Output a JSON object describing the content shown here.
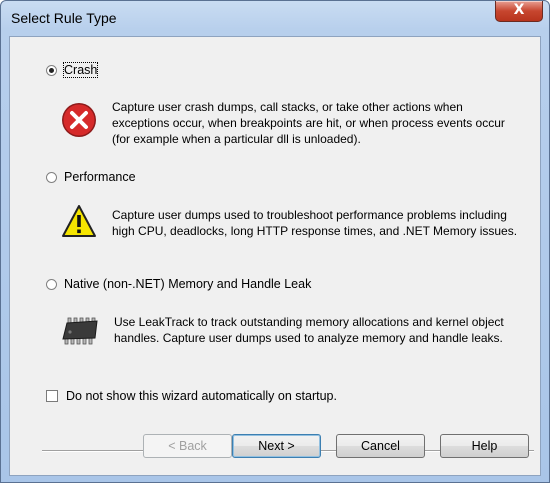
{
  "window": {
    "title": "Select Rule Type",
    "close_glyph": "X"
  },
  "options": [
    {
      "label": "Crash",
      "selected": true,
      "icon": "error-icon",
      "description": "Capture user crash dumps, call stacks, or take other actions when exceptions occur, when breakpoints are hit, or when process events occur (for example when a particular dll is unloaded)."
    },
    {
      "label": "Performance",
      "selected": false,
      "icon": "warning-icon",
      "description": "Capture user dumps used to troubleshoot performance problems including high CPU, deadlocks, long HTTP response times, and .NET Memory issues."
    },
    {
      "label": "Native (non-.NET) Memory and Handle Leak",
      "selected": false,
      "icon": "chip-icon",
      "description": "Use LeakTrack to track outstanding memory allocations and kernel object handles. Capture user dumps used to analyze memory and handle leaks."
    }
  ],
  "startup_checkbox": {
    "label": "Do not show this wizard automatically on startup.",
    "checked": false
  },
  "buttons": {
    "back": "< Back",
    "next": "Next >",
    "cancel": "Cancel",
    "help": "Help"
  },
  "colors": {
    "error_red": "#d62a2a",
    "warning_yellow": "#f5e500",
    "title_bar": "#b7cfec"
  }
}
